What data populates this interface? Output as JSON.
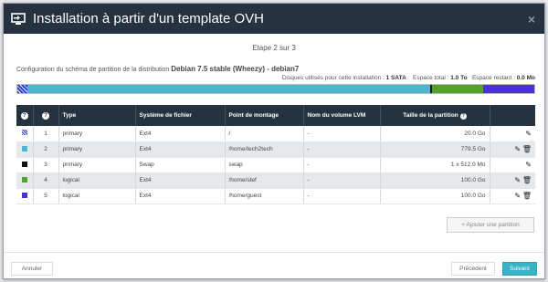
{
  "modal": {
    "title": "Installation à partir d'un template OVH",
    "close_icon": "×",
    "step": "Etape 2 sur 3"
  },
  "config": {
    "label": "Configuration du schéma de partition de la distribution",
    "distribution": "Debian 7.5 stable (Wheezy) - debian7"
  },
  "disks": {
    "used_label": "Disques utilisés pour cette installation :",
    "used_value": "1 SATA",
    "total_label": "Espace total :",
    "total_value": "1.0 To",
    "remaining_label": "Espace restant :",
    "remaining_value": "0.0 Mo"
  },
  "partition_bar": [
    {
      "color": "#2c3fc8",
      "pattern": true,
      "fraction": 0.02
    },
    {
      "color": "#4db6cc",
      "fraction": 0.785
    },
    {
      "color": "#111111",
      "fraction": 0.004
    },
    {
      "color": "#55a02a",
      "fraction": 0.1
    },
    {
      "color": "#4a32d0",
      "fraction": 0.1
    }
  ],
  "table": {
    "headers": {
      "color": "?",
      "order": "?",
      "type": "Type",
      "fs": "Système de fichier",
      "mount": "Point de montage",
      "lvm": "Nom du volume LVM",
      "size": "Taille de la partition"
    },
    "rows": [
      {
        "color": "#2c3fc8",
        "order": "1",
        "type": "primary",
        "fs": "Ext4",
        "mount": "/",
        "lvm": "-",
        "size": "20.0 Go",
        "deletable": false
      },
      {
        "color": "#4db6cc",
        "order": "2",
        "type": "primary",
        "fs": "Ext4",
        "mount": "/home/tech2tech",
        "lvm": "-",
        "size": "779.5 Go",
        "deletable": true
      },
      {
        "color": "#111111",
        "order": "3",
        "type": "primary",
        "fs": "Swap",
        "mount": "swap",
        "lvm": "-",
        "size": "1 x 512.0 Mo",
        "deletable": false
      },
      {
        "color": "#55a02a",
        "order": "4",
        "type": "logical",
        "fs": "Ext4",
        "mount": "/home/stef",
        "lvm": "-",
        "size": "100.0 Go",
        "deletable": true
      },
      {
        "color": "#4a32d0",
        "order": "5",
        "type": "logical",
        "fs": "Ext4",
        "mount": "/home/guest",
        "lvm": "-",
        "size": "100.0 Go",
        "deletable": true
      }
    ]
  },
  "buttons": {
    "add_partition": "+ Ajouter une partition",
    "cancel": "Annuler",
    "previous": "Précédent",
    "next": "Suivant"
  },
  "icons": {
    "edit": "✎",
    "delete": "🗑"
  }
}
